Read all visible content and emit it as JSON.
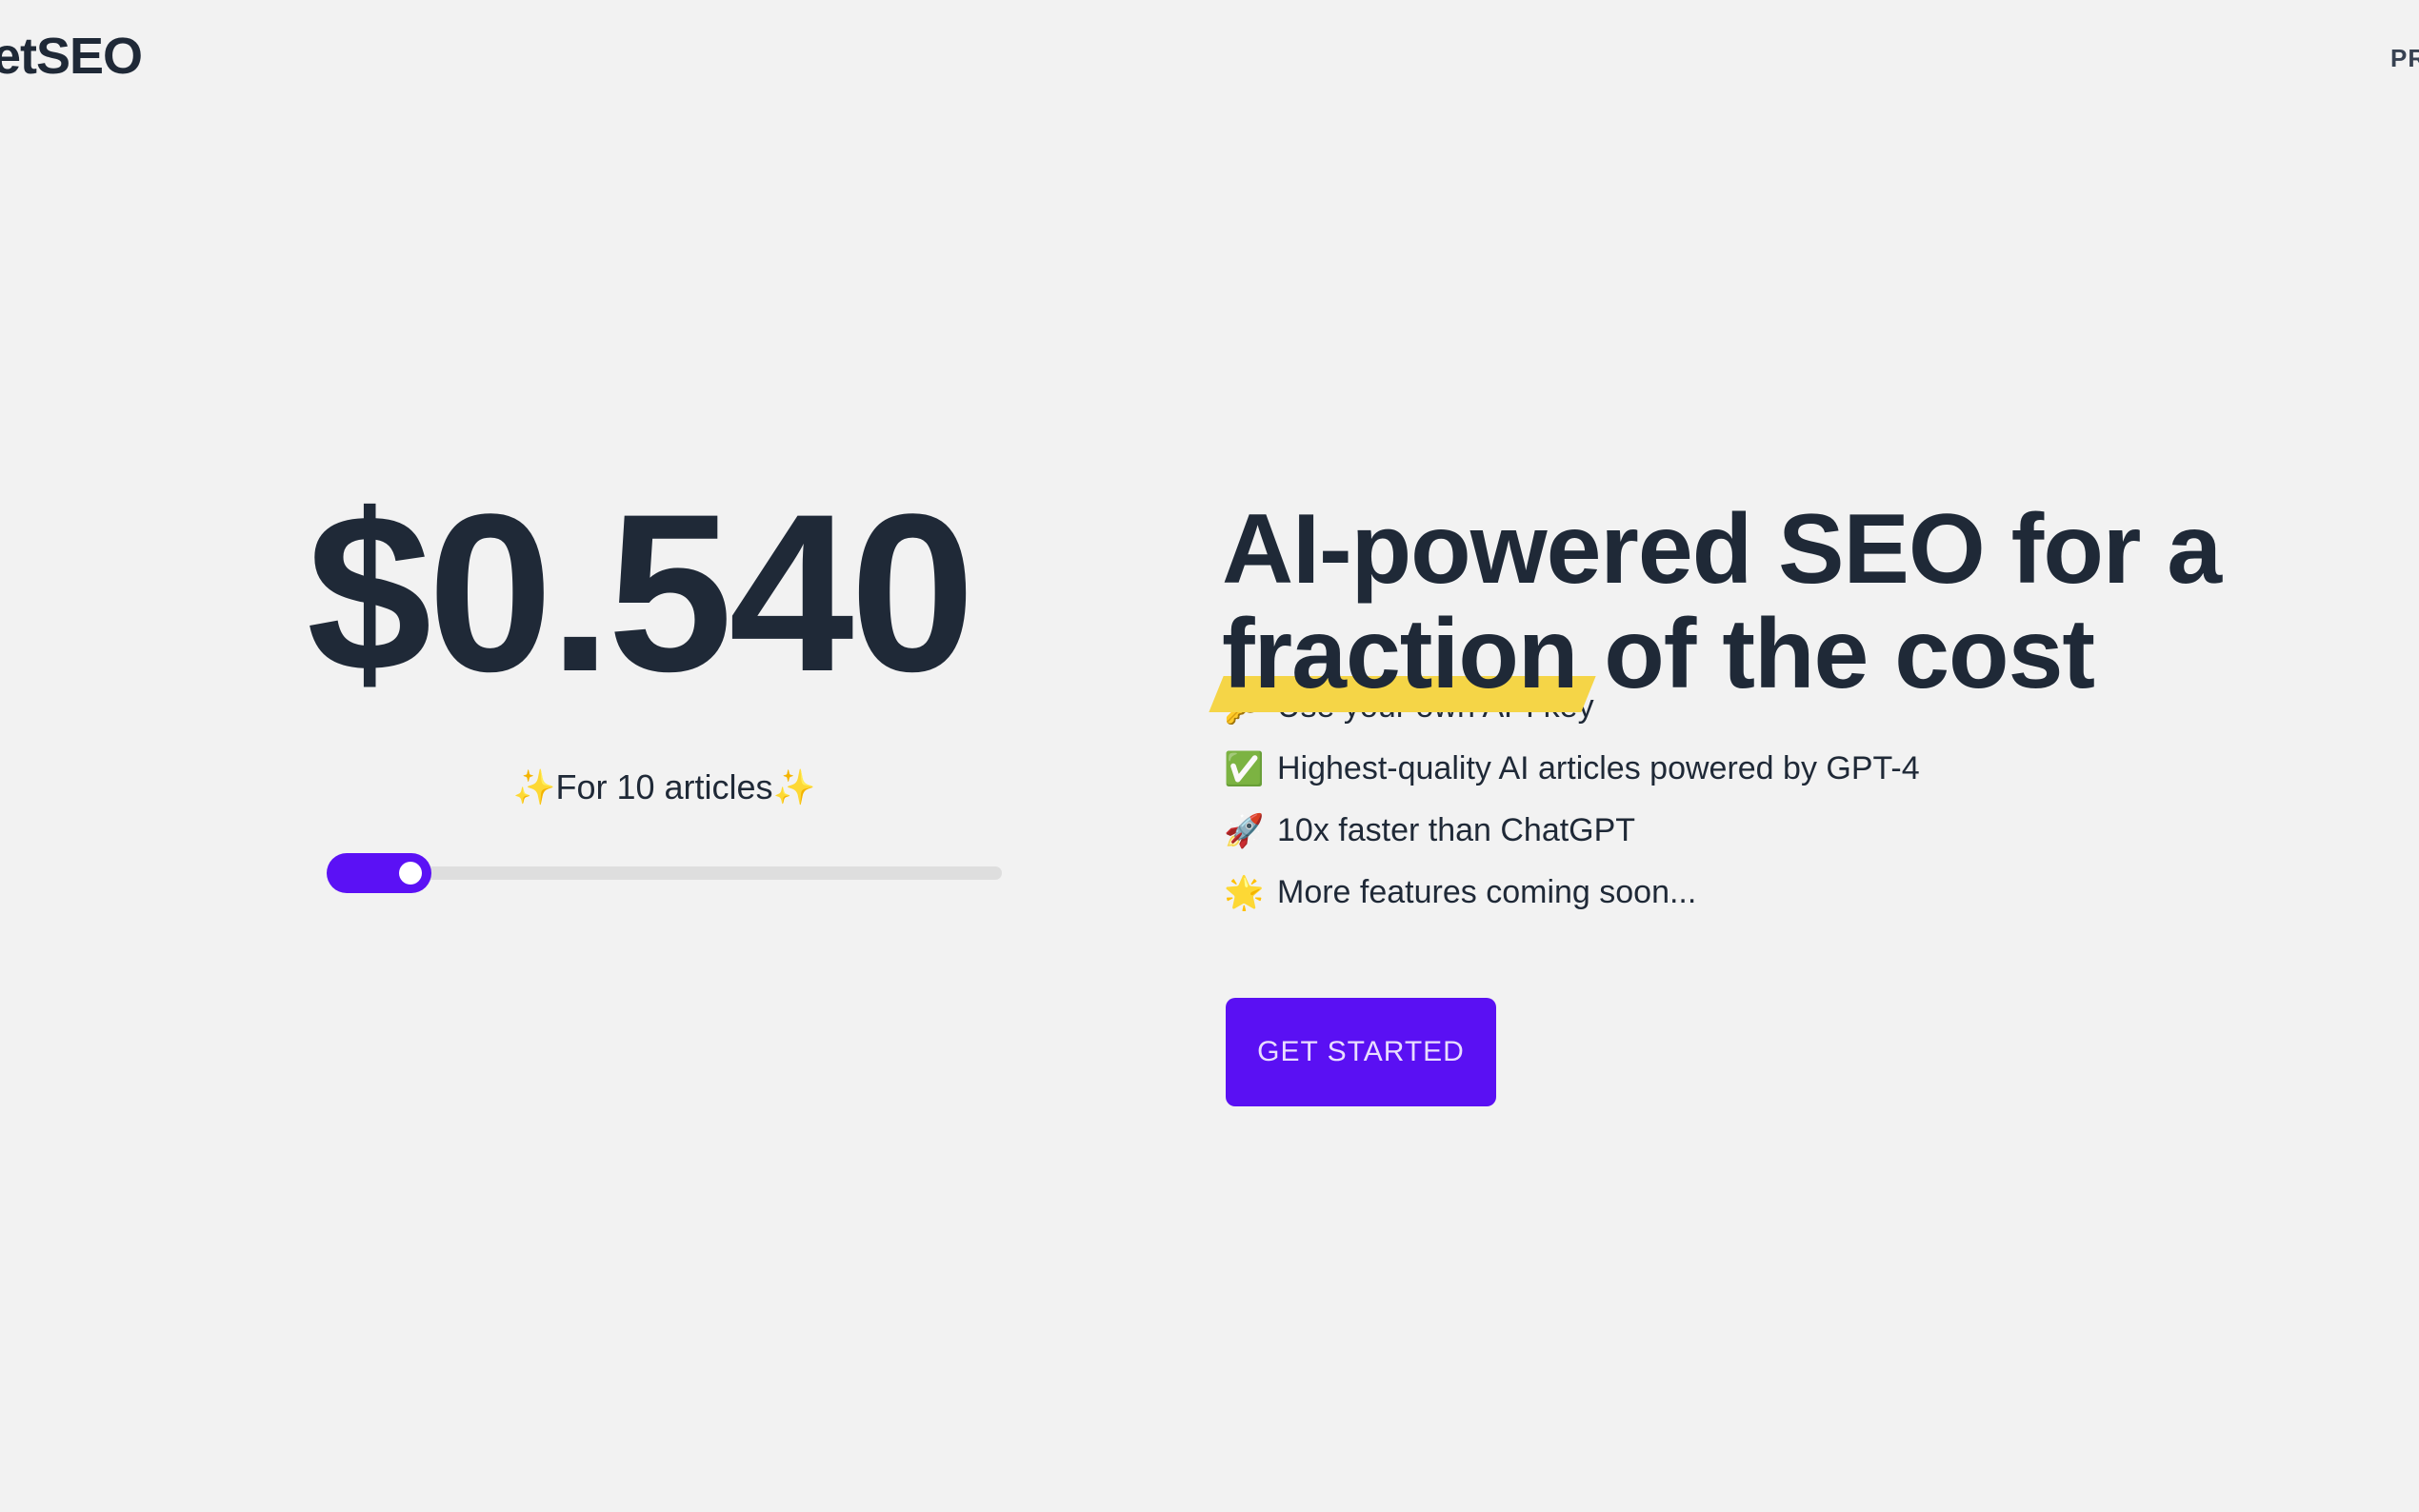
{
  "header": {
    "logo_text": "etSEO",
    "nav_link": "PR"
  },
  "pricing": {
    "price": "$0.540",
    "caption": "✨For 10 articles✨",
    "slider": {
      "min": 10,
      "max": 100,
      "value": 10,
      "fill_fraction": 0.155
    }
  },
  "hero": {
    "headline_line1": "AI-powered SEO for a",
    "headline_highlight": "fraction",
    "headline_line2_rest": " of the cost",
    "features": [
      {
        "icon": "🔑",
        "icon_name": "key-icon",
        "text": "Use your own API key"
      },
      {
        "icon": "✅",
        "icon_name": "check-icon",
        "text": "Highest-quality AI articles powered by GPT-4"
      },
      {
        "icon": "🚀",
        "icon_name": "rocket-icon",
        "text": "10x faster than ChatGPT"
      },
      {
        "icon": "🌟",
        "icon_name": "star-icon",
        "text": "More features coming soon..."
      }
    ],
    "cta_label": "GET STARTED"
  },
  "colors": {
    "accent": "#5a10f3",
    "highlight": "#f5d547",
    "background": "#f2f2f2"
  }
}
